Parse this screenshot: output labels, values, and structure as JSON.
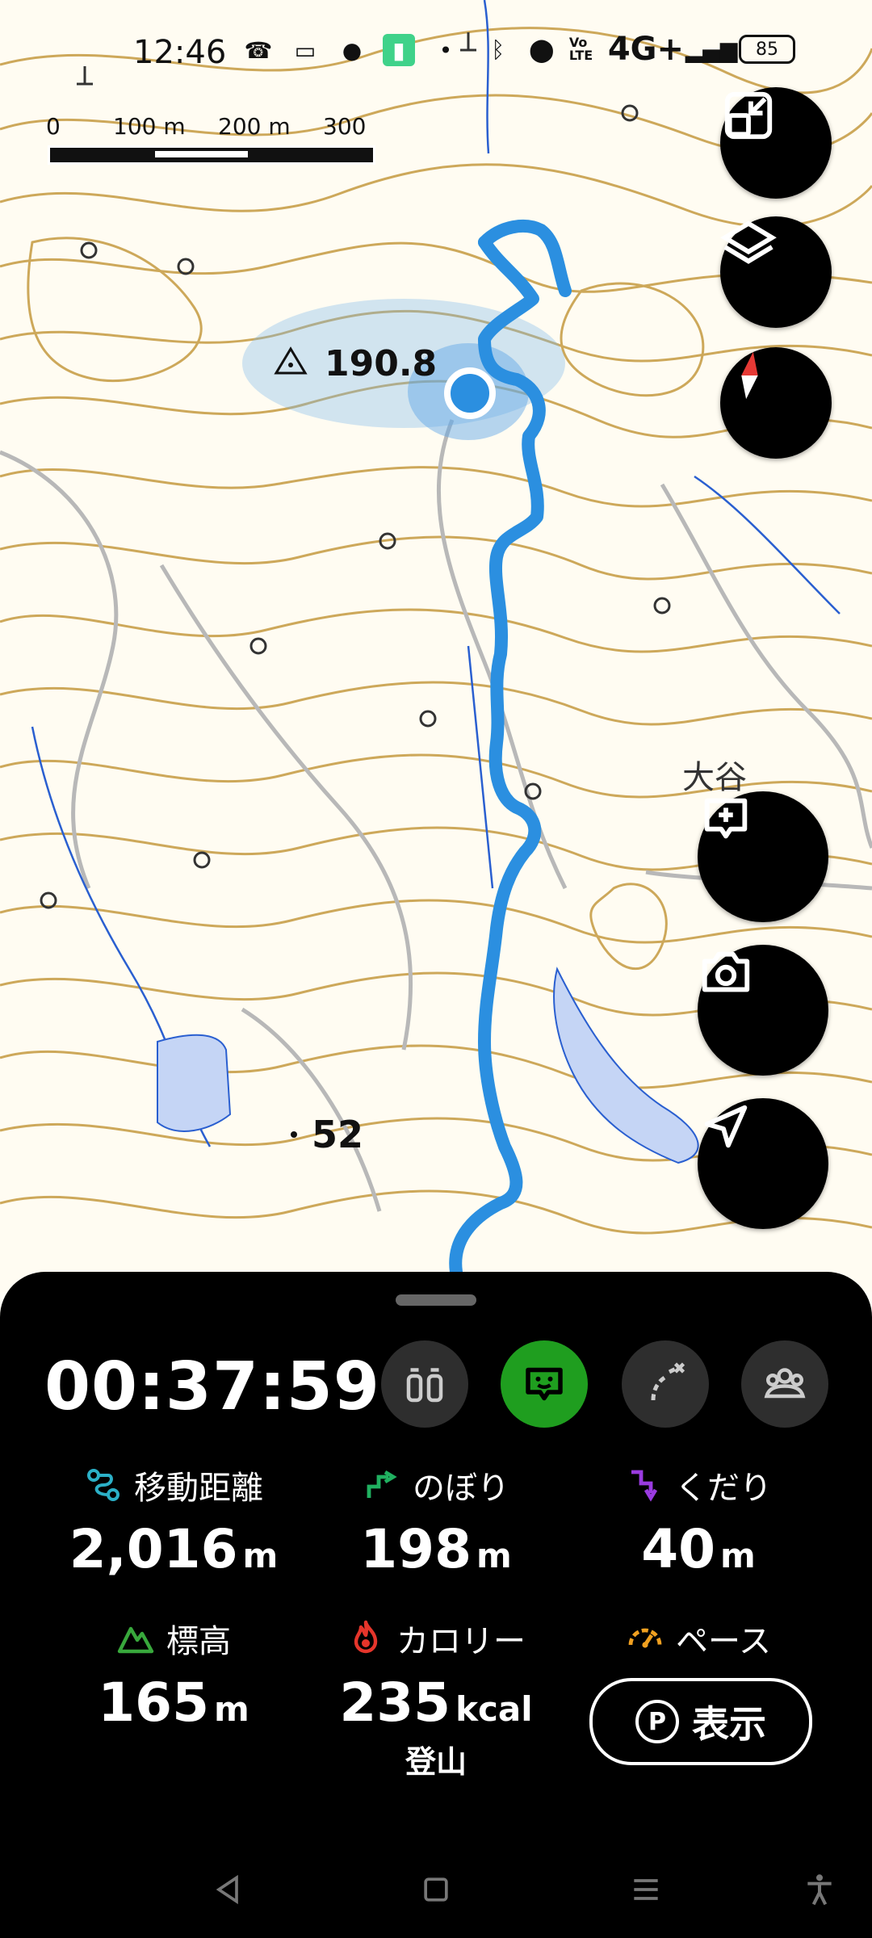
{
  "status_bar": {
    "time": "12:46",
    "network": "4G+",
    "volte": "Vo LTE",
    "battery": "85"
  },
  "scale": {
    "labels": [
      "0",
      "100 m",
      "200 m",
      "300 m"
    ]
  },
  "map": {
    "peak_elevation": "190.8",
    "spot_elevation": "52",
    "place_name": "大谷"
  },
  "panel": {
    "timer": "00:37:59",
    "stats": [
      {
        "label": "移動距離",
        "value": "2,016",
        "unit": "m",
        "icon": "route-icon",
        "color": "#2bb0c7"
      },
      {
        "label": "のぼり",
        "value": "198",
        "unit": "m",
        "icon": "ascent-icon",
        "color": "#20b060"
      },
      {
        "label": "くだり",
        "value": "40",
        "unit": "m",
        "icon": "descent-icon",
        "color": "#9a3be0"
      },
      {
        "label": "標高",
        "value": "165",
        "unit": "m",
        "icon": "mountain-icon",
        "color": "#38a83c"
      },
      {
        "label": "カロリー",
        "value": "235",
        "unit": "kcal",
        "icon": "flame-icon",
        "color": "#e5352b",
        "sub": "登山"
      },
      {
        "label": "ペース",
        "icon": "speedometer-icon",
        "color": "#f0a020"
      }
    ],
    "show_button": {
      "badge": "P",
      "label": "表示"
    }
  },
  "colors": {
    "route": "#2b8fe0",
    "contour": "#c8a04a",
    "road": "#b8b8b8",
    "water": "#2a5fd0"
  }
}
